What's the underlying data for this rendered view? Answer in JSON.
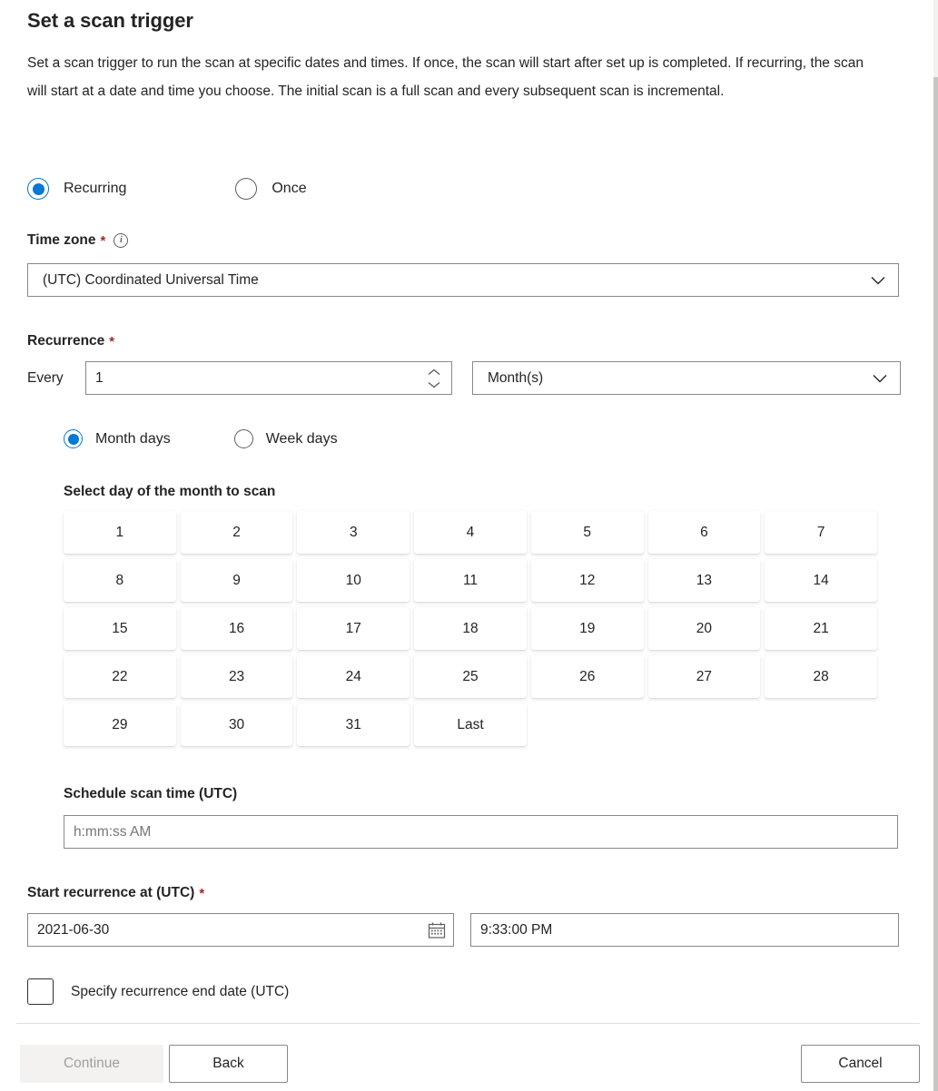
{
  "page": {
    "title": "Set a scan trigger",
    "description": "Set a scan trigger to run the scan at specific dates and times. If once, the scan will start after set up is completed. If recurring, the scan will start at a date and time you choose. The initial scan is a full scan and every subsequent scan is incremental."
  },
  "trigger_mode": {
    "options": [
      {
        "label": "Recurring",
        "selected": true
      },
      {
        "label": "Once",
        "selected": false
      }
    ]
  },
  "timezone": {
    "label": "Time zone",
    "required_marker": "*",
    "info_glyph": "i",
    "value": "(UTC) Coordinated Universal Time"
  },
  "recurrence": {
    "label": "Recurrence",
    "required_marker": "*",
    "every_label": "Every",
    "interval_value": "1",
    "unit_value": "Month(s)",
    "day_type": {
      "options": [
        {
          "label": "Month days",
          "selected": true
        },
        {
          "label": "Week days",
          "selected": false
        }
      ]
    },
    "day_grid_label": "Select day of the month to scan",
    "days": [
      "1",
      "2",
      "3",
      "4",
      "5",
      "6",
      "7",
      "8",
      "9",
      "10",
      "11",
      "12",
      "13",
      "14",
      "15",
      "16",
      "17",
      "18",
      "19",
      "20",
      "21",
      "22",
      "23",
      "24",
      "25",
      "26",
      "27",
      "28",
      "29",
      "30",
      "31",
      "Last"
    ]
  },
  "schedule_time": {
    "label": "Schedule scan time (UTC)",
    "placeholder": "h:mm:ss AM",
    "value": ""
  },
  "start_recurrence": {
    "label": "Start recurrence at (UTC)",
    "required_marker": "*",
    "date_value": "2021-06-30",
    "time_value": "9:33:00 PM"
  },
  "end_date_checkbox": {
    "label": "Specify recurrence end date (UTC)",
    "checked": false
  },
  "footer": {
    "continue_label": "Continue",
    "back_label": "Back",
    "cancel_label": "Cancel"
  },
  "colors": {
    "accent": "#0078d4",
    "required": "#a4262c",
    "text": "#242424",
    "border": "#8a8886",
    "disabled_bg": "#f3f2f1",
    "disabled_text": "#a19f9d"
  }
}
